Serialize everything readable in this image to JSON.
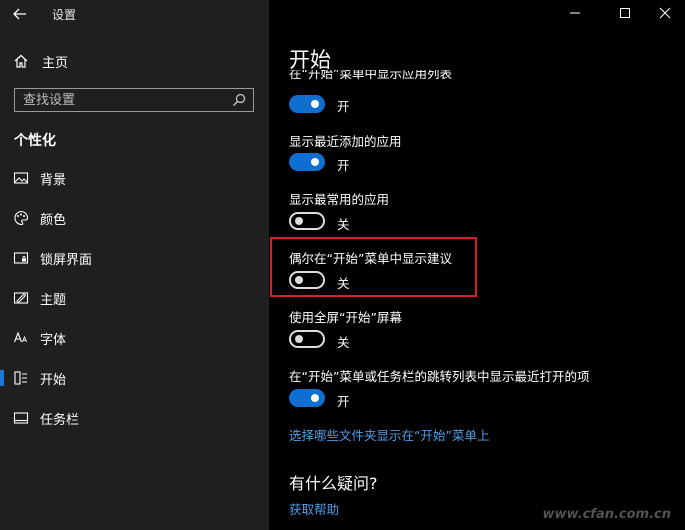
{
  "window": {
    "title": "设置",
    "back_icon": "back-arrow-icon",
    "minimize_icon": "minimize-icon",
    "maximize_icon": "maximize-icon",
    "close_icon": "close-icon"
  },
  "sidebar": {
    "home_label": "主页",
    "search_placeholder": "查找设置",
    "section_title": "个性化",
    "items": [
      {
        "label": "背景",
        "icon": "picture-icon"
      },
      {
        "label": "颜色",
        "icon": "palette-icon"
      },
      {
        "label": "锁屏界面",
        "icon": "lock-screen-icon"
      },
      {
        "label": "主题",
        "icon": "theme-icon"
      },
      {
        "label": "字体",
        "icon": "font-icon"
      },
      {
        "label": "开始",
        "icon": "start-icon",
        "active": true
      },
      {
        "label": "任务栏",
        "icon": "taskbar-icon"
      }
    ]
  },
  "main": {
    "title": "开始",
    "settings": [
      {
        "label": "在“开始”菜单中显示应用列表",
        "state": "开",
        "on": true
      },
      {
        "label": "显示最近添加的应用",
        "state": "开",
        "on": true
      },
      {
        "label": "显示最常用的应用",
        "state": "关",
        "on": false
      },
      {
        "label": "偶尔在“开始”菜单中显示建议",
        "state": "关",
        "on": false,
        "highlighted": true
      },
      {
        "label": "使用全屏“开始”屏幕",
        "state": "关",
        "on": false
      },
      {
        "label": "在“开始”菜单或任务栏的跳转列表中显示最近打开的项",
        "state": "开",
        "on": true
      }
    ],
    "folders_link": "选择哪些文件夹显示在“开始”菜单上",
    "help_title": "有什么疑问?",
    "help_link": "获取帮助"
  },
  "watermark": "www.cfan.com.cn",
  "colors": {
    "accent": "#0f6fd1",
    "link": "#4f9ee8",
    "highlight": "#d61f26",
    "sidebar_bg": "#1f1f1f",
    "main_bg": "#000000"
  }
}
